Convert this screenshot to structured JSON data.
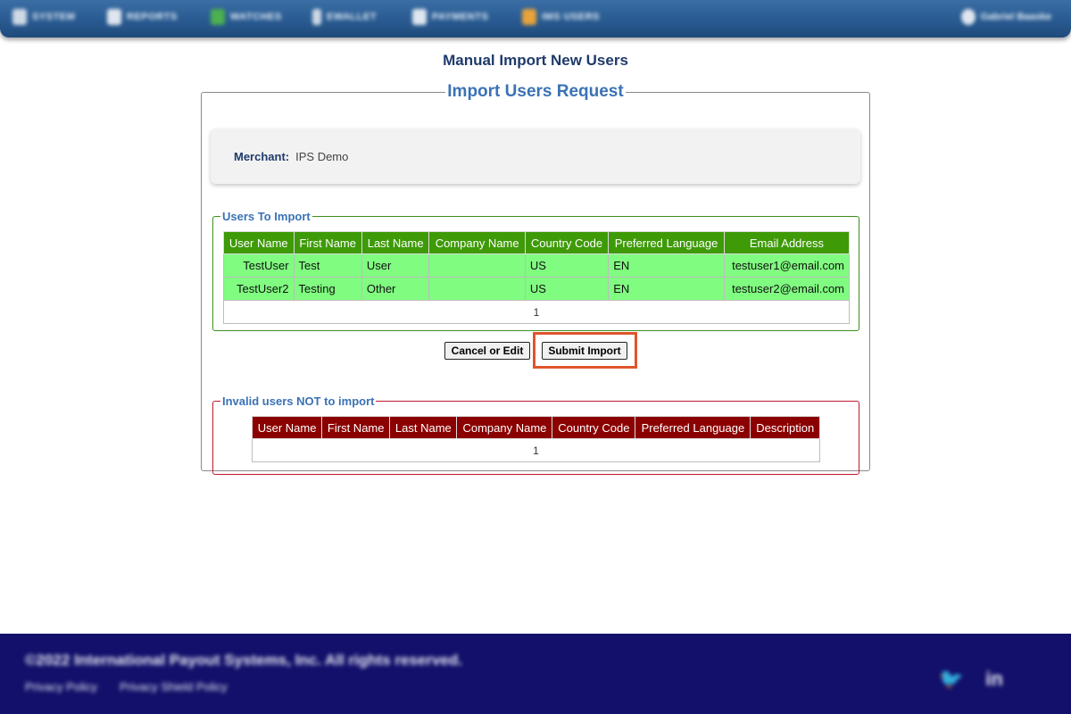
{
  "nav": {
    "items": [
      {
        "label": "SYSTEM",
        "icon": "system-icon",
        "color": "#cfd9e6"
      },
      {
        "label": "REPORTS",
        "icon": "reports-icon",
        "color": "#dfe6ef"
      },
      {
        "label": "WATCHES",
        "icon": "watches-icon",
        "color": "#4caf50"
      },
      {
        "label": "EWALLET",
        "icon": "ewallet-icon",
        "color": "#cfd9e6"
      },
      {
        "label": "PAYMENTS",
        "icon": "payments-icon",
        "color": "#dfe6ef"
      },
      {
        "label": "IMS USERS",
        "icon": "users-icon",
        "color": "#e8a33a"
      }
    ],
    "user": "Gabriel Baaske"
  },
  "page_title": "Manual Import New Users",
  "main_legend": "Import Users Request",
  "merchant": {
    "label": "Merchant:",
    "value": "IPS Demo"
  },
  "import_section": {
    "legend": "Users To Import",
    "columns": [
      "User Name",
      "First Name",
      "Last Name",
      "Company Name",
      "Country Code",
      "Preferred Language",
      "Email Address"
    ],
    "rows": [
      [
        "TestUser",
        "Test",
        "User",
        "",
        "US",
        "EN",
        "testuser1@email.com"
      ],
      [
        "TestUser2",
        "Testing",
        "Other",
        "",
        "US",
        "EN",
        "testuser2@email.com"
      ]
    ],
    "page": "1"
  },
  "buttons": {
    "cancel": "Cancel or Edit",
    "submit": "Submit Import"
  },
  "invalid_section": {
    "legend": "Invalid users NOT to import",
    "columns": [
      "User Name",
      "First Name",
      "Last Name",
      "Company Name",
      "Country Code",
      "Preferred Language",
      "Description"
    ],
    "page": "1"
  },
  "footer": {
    "copyright": "©2022 International Payout Systems, Inc. All rights reserved.",
    "links": [
      "Privacy Policy",
      "Privacy Shield Policy"
    ],
    "social": [
      {
        "icon": "twitter-icon",
        "glyph": "🐦"
      },
      {
        "icon": "linkedin-icon",
        "glyph": "in"
      }
    ]
  },
  "colors": {
    "import_header": "#3e9a07",
    "import_row": "#80fc80",
    "invalid_header": "#8b0000",
    "highlight": "#e0552b",
    "footer_bg": "#12106a"
  }
}
